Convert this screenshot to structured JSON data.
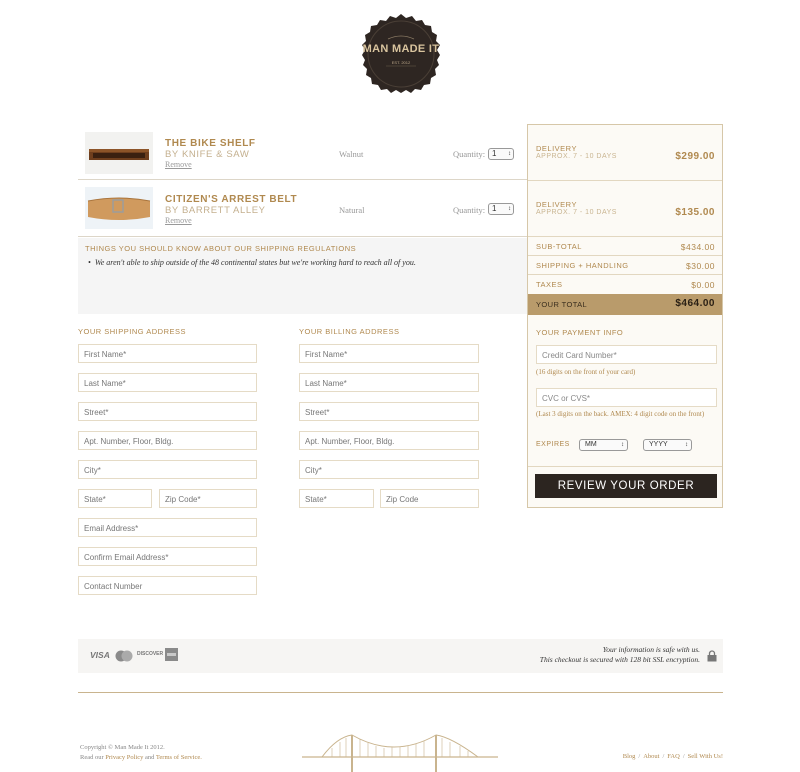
{
  "brand": {
    "logo_text": "MAN MADE IT",
    "logo_sub": "EST. 2012"
  },
  "cart": {
    "items": [
      {
        "name": "THE BIKE SHELF",
        "by": "BY KNIFE & SAW",
        "remove": "Remove",
        "variant": "Walnut",
        "quantity_label": "Quantity:",
        "quantity": "1"
      },
      {
        "name": "CITIZEN'S ARREST BELT",
        "by": "BY BARRETT ALLEY",
        "remove": "Remove",
        "variant": "Natural",
        "quantity_label": "Quantity:",
        "quantity": "1"
      }
    ],
    "shipping_note": {
      "title": "THINGS YOU SHOULD KNOW ABOUT OUR SHIPPING REGULATIONS",
      "items": [
        "We aren't able to ship outside of the 48 continental states but we're working hard to reach all of you."
      ]
    }
  },
  "summary": {
    "deliveries": [
      {
        "label": "DELIVERY",
        "estimate": "APPROX. 7 - 10 DAYS",
        "price": "$299.00"
      },
      {
        "label": "DELIVERY",
        "estimate": "APPROX. 7 - 10 DAYS",
        "price": "$135.00"
      }
    ],
    "subtotal": {
      "label": "SUB-TOTAL",
      "value": "$434.00"
    },
    "shipping": {
      "label": "SHIPPING + HANDLING",
      "value": "$30.00"
    },
    "taxes": {
      "label": "TAXES",
      "value": "$0.00"
    },
    "total": {
      "label": "YOUR TOTAL",
      "value": "$464.00"
    },
    "payment": {
      "title": "YOUR PAYMENT INFO",
      "card_placeholder": "Credit Card Number*",
      "card_hint": "(16 digits on the front of your card)",
      "cvc_placeholder": "CVC or CVS*",
      "cvc_hint": "(Last 3 digits on the back. AMEX: 4 digit code on the front)",
      "expires_label": "EXPIRES",
      "month_value": "MM",
      "year_value": "YYYY"
    },
    "review_button": "REVIEW YOUR ORDER"
  },
  "shipping_address": {
    "title": "YOUR SHIPPING ADDRESS",
    "first_name": "First Name*",
    "last_name": "Last Name*",
    "street": "Street*",
    "apt": "Apt. Number, Floor, Bldg.",
    "city": "City*",
    "state": "State*",
    "zip": "Zip Code*",
    "email": "Email Address*",
    "confirm_email": "Confirm Email Address*",
    "contact": "Contact Number"
  },
  "billing_address": {
    "title": "YOUR BILLING ADDRESS",
    "first_name": "First Name*",
    "last_name": "Last Name*",
    "street": "Street*",
    "apt": "Apt. Number, Floor, Bldg.",
    "city": "City*",
    "state": "State*",
    "zip": "Zip Code"
  },
  "security": {
    "cards": [
      "VISA",
      "MC",
      "DISCOVER",
      "AMEX"
    ],
    "line1": "Your information is safe with us.",
    "line2": "This checkout is secured with 128 bit SSL encryption."
  },
  "footer": {
    "copyright": "Copyright © Man Made It 2012.",
    "read_our": "Read our",
    "privacy": "Privacy Policy",
    "and": "and",
    "terms": "Terms of Service.",
    "links": [
      "Blog",
      "About",
      "FAQ",
      "Sell With Us!"
    ]
  },
  "colors": {
    "accent": "#b0894f",
    "total_bar": "#b99b6b",
    "button": "#2c2520",
    "logo_bg": "#2e2622"
  }
}
